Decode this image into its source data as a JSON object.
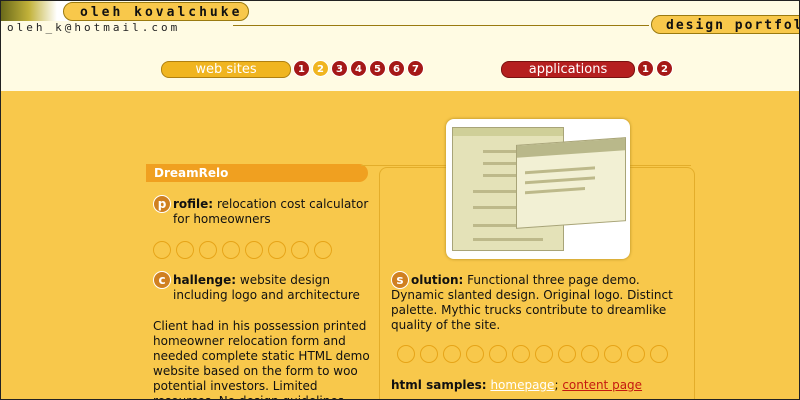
{
  "header": {
    "name": "oleh kovalchuke",
    "email": "oleh_k@hotmail.com",
    "portfolio_label": "design portfol"
  },
  "nav": {
    "web_sites_label": "web sites",
    "web_pages": [
      "1",
      "2",
      "3",
      "4",
      "5",
      "6",
      "7"
    ],
    "active_page": "2",
    "applications_label": "applications",
    "app_pages": [
      "1",
      "2"
    ]
  },
  "project": {
    "title": "DreamRelo",
    "profile_letter": "p",
    "profile_label": "rofile:",
    "profile_text": "relocation cost calculator for homeowners",
    "challenge_letter": "c",
    "challenge_label": "hallenge:",
    "challenge_text": "website design including logo and architecture",
    "description": "Client had in his possession printed homeowner relocation form and needed complete static HTML demo website based on the form to woo potential investors. Limited resources. No design guidelines.",
    "solution_letter": "s",
    "solution_label": "olution:",
    "solution_text": "Functional three page demo. Dynamic slanted design. Original logo. Distinct palette. Mythic trucks contribute to dreamlike quality of the site.",
    "samples_label": "html samples:",
    "sample_homepage": "homepage",
    "sample_separator": ";",
    "sample_content_page": "content page"
  },
  "colors": {
    "background": "#f8c84b",
    "header_bg": "#fffbe3",
    "accent_red": "#b51f1f",
    "accent_orange": "#f0a020",
    "link_white": "#ffffff",
    "link_red": "#c41a10"
  }
}
